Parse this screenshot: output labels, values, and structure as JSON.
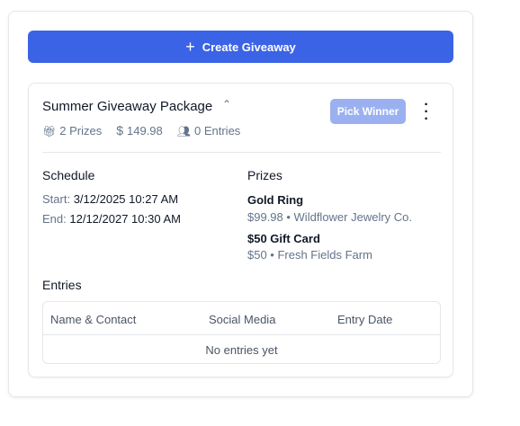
{
  "create_button": {
    "label": "Create Giveaway",
    "icon": "plus-icon"
  },
  "giveaway": {
    "title": "Summer Giveaway Package",
    "prizes_count": "2 Prizes",
    "total_value": "149.98",
    "entries_count": "0 Entries",
    "pick_winner_label": "Pick Winner",
    "schedule": {
      "heading": "Schedule",
      "start_label": "Start:",
      "start": "3/12/2025 10:27 AM",
      "end_label": "End:",
      "end": "12/12/2027 10:30 AM"
    },
    "prizes": {
      "heading": "Prizes",
      "items": [
        {
          "name": "Gold Ring",
          "detail": "$99.98 • Wildflower Jewelry Co."
        },
        {
          "name": "$50 Gift Card",
          "detail": "$50 • Fresh Fields Farm"
        }
      ]
    },
    "entries": {
      "heading": "Entries",
      "columns": [
        "Name & Contact",
        "Social Media",
        "Entry Date"
      ],
      "empty": "No entries yet"
    }
  },
  "colors": {
    "primary": "#3b63e5",
    "disabled_primary": "#9bb0f0"
  }
}
